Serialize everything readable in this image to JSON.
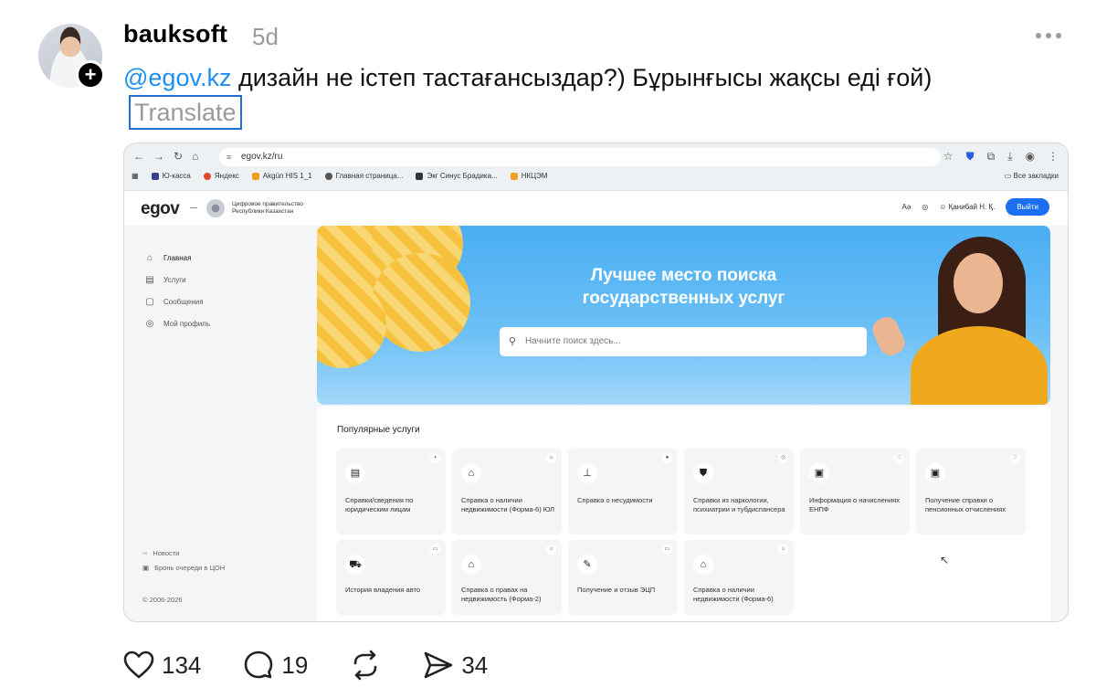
{
  "post": {
    "username": "bauksoft",
    "time": "5d",
    "mention": "@egov.kz",
    "text": " дизайн не істеп тастағансыздар?) Бұрынғысы жақсы еді ғой)",
    "translate_label": "Translate"
  },
  "actions": {
    "likes": "134",
    "replies": "19",
    "shares": "34"
  },
  "screenshot": {
    "browser": {
      "url": "egov.kz/ru",
      "bookmarks": [
        "Ю-касса",
        "Яндекс",
        "Akgün HIS 1_1",
        "Главная страница...",
        "Экг Синус Брадика...",
        "НКЦЭМ"
      ],
      "all_bookmarks": "Все закладки"
    },
    "header": {
      "logo": "egov",
      "dash": "–",
      "gov_name": "Цифровое правительство Республики Казахстан",
      "user_name": "Қанибай Н. Қ.",
      "logout": "Выйти"
    },
    "sidebar": {
      "items": [
        "Главная",
        "Услуги",
        "Сообщения",
        "Мой профиль"
      ],
      "bottom": [
        "Новости",
        "Бронь очереди в ЦОН",
        "© 2006-2026"
      ]
    },
    "hero": {
      "title_line1": "Лучшее место поиска",
      "title_line2": "государственных услуг",
      "search_placeholder": "Начните поиск здесь..."
    },
    "popular": {
      "title": "Популярные услуги",
      "services": [
        "Справки/сведения по юридическим лицам",
        "Справка о наличии недвижимости (Форма-6) ЮЛ",
        "Справка о несудимости",
        "Справки из наркологии, психиатрии и тубдиспансера",
        "Информация о начислениях ЕНПФ",
        "Получение справки о пенсионных отчислениях",
        "История владения авто",
        "Справка о правах на недвижимость (Форма-2)",
        "Получение и отзыв ЭЦП",
        "Справка о наличии недвижимости (Форма-6)"
      ]
    }
  }
}
